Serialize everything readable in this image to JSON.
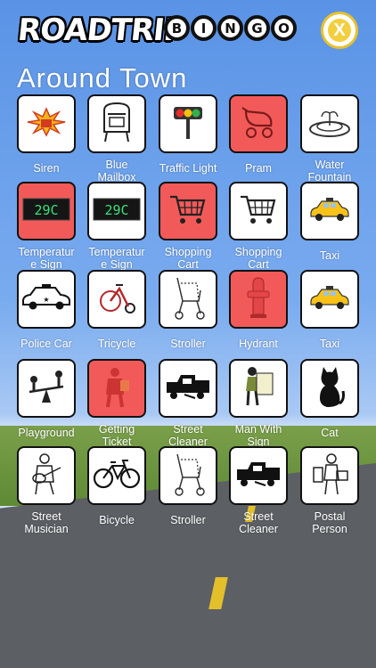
{
  "header": {
    "logo_text": "ROADTRIP",
    "bingo_letters": [
      "B",
      "I",
      "N",
      "G",
      "O"
    ],
    "close_label": "X"
  },
  "section": {
    "title": "Around  Town"
  },
  "tiles": [
    {
      "label": "Siren",
      "icon": "siren-icon",
      "marked": false
    },
    {
      "label": "Blue Mailbox",
      "icon": "mailbox-icon",
      "marked": false
    },
    {
      "label": "Traffic Light",
      "icon": "traffic-light-icon",
      "marked": false
    },
    {
      "label": "Pram",
      "icon": "pram-icon",
      "marked": true
    },
    {
      "label": "Water Fountain",
      "icon": "fountain-icon",
      "marked": false
    },
    {
      "label": "Temperature Sign",
      "icon": "temperature-sign-icon",
      "marked": true,
      "display": "29C"
    },
    {
      "label": "Temperature Sign",
      "icon": "temperature-sign-icon",
      "marked": false,
      "display": "29C"
    },
    {
      "label": "Shopping Cart",
      "icon": "shopping-cart-icon",
      "marked": true
    },
    {
      "label": "Shopping Cart",
      "icon": "shopping-cart-icon",
      "marked": false
    },
    {
      "label": "Taxi",
      "icon": "taxi-icon",
      "marked": false
    },
    {
      "label": "Police Car",
      "icon": "police-car-icon",
      "marked": false
    },
    {
      "label": "Tricycle",
      "icon": "tricycle-icon",
      "marked": false
    },
    {
      "label": "Stroller",
      "icon": "stroller-icon",
      "marked": false
    },
    {
      "label": "Hydrant",
      "icon": "hydrant-icon",
      "marked": true
    },
    {
      "label": "Taxi",
      "icon": "taxi-icon",
      "marked": false
    },
    {
      "label": "Playground",
      "icon": "seesaw-icon",
      "marked": false
    },
    {
      "label": "Getting Ticket",
      "icon": "ticket-officer-icon",
      "marked": true
    },
    {
      "label": "Street Cleaner",
      "icon": "street-cleaner-icon",
      "marked": false
    },
    {
      "label": "Man With Sign",
      "icon": "sign-man-icon",
      "marked": false
    },
    {
      "label": "Cat",
      "icon": "cat-icon",
      "marked": false
    },
    {
      "label": "Street Musician",
      "icon": "guitarist-icon",
      "marked": false
    },
    {
      "label": "Bicycle",
      "icon": "bicycle-icon",
      "marked": false
    },
    {
      "label": "Stroller",
      "icon": "stroller-icon",
      "marked": false
    },
    {
      "label": "Street Cleaner",
      "icon": "street-cleaner-icon",
      "marked": false
    },
    {
      "label": "Postal Person",
      "icon": "postal-person-icon",
      "marked": false
    }
  ],
  "label_lines": [
    [
      "Siren"
    ],
    [
      "Blue",
      "Mailbox"
    ],
    [
      "Traffic Light"
    ],
    [
      "Pram"
    ],
    [
      "Water",
      "Fountain"
    ],
    [
      "Temperatur",
      "e Sign"
    ],
    [
      "Temperatur",
      "e Sign"
    ],
    [
      "Shopping",
      "Cart"
    ],
    [
      "Shopping",
      "Cart"
    ],
    [
      "Taxi"
    ],
    [
      "Police Car"
    ],
    [
      "Tricycle"
    ],
    [
      "Stroller"
    ],
    [
      "Hydrant"
    ],
    [
      "Taxi"
    ],
    [
      "Playground"
    ],
    [
      "Getting",
      "Ticket"
    ],
    [
      "Street",
      "Cleaner"
    ],
    [
      "Man With",
      "Sign"
    ],
    [
      "Cat"
    ],
    [
      "Street",
      "Musician"
    ],
    [
      "Bicycle"
    ],
    [
      "Stroller"
    ],
    [
      "Street",
      "Cleaner"
    ],
    [
      "Postal",
      "Person"
    ]
  ],
  "colors": {
    "marked_tile": "#f25a5a",
    "sky": "#5a93e6",
    "close_accent": "#e8c22c"
  }
}
